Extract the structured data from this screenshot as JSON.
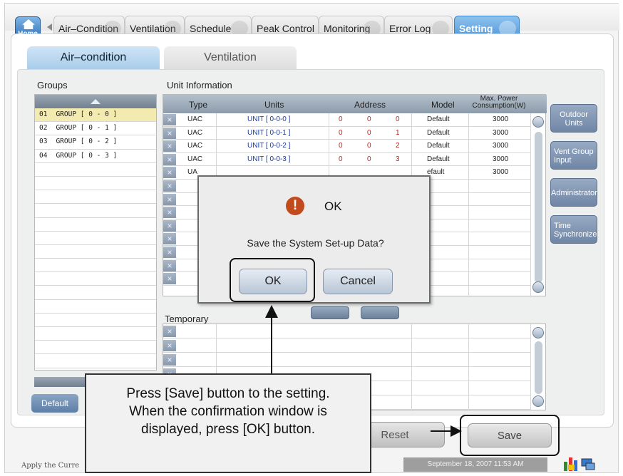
{
  "top_tabs": [
    {
      "label": "Air–Condition"
    },
    {
      "label": "Ventilation"
    },
    {
      "label": "Schedule"
    },
    {
      "label": "Peak Control"
    },
    {
      "label": "Monitoring"
    },
    {
      "label": "Error Log"
    },
    {
      "label": "Setting"
    }
  ],
  "home_label": "Home",
  "sub_tabs": {
    "air": "Air–condition",
    "vent": "Ventilation"
  },
  "groups": {
    "heading": "Groups",
    "items": [
      {
        "num": "01",
        "name": "GROUP [ 0 - 0 ]"
      },
      {
        "num": "02",
        "name": "GROUP [ 0 - 1 ]"
      },
      {
        "num": "03",
        "name": "GROUP [ 0 - 2 ]"
      },
      {
        "num": "04",
        "name": "GROUP [ 0 - 3 ]"
      }
    ]
  },
  "unit_info": {
    "heading": "Unit Information",
    "columns": {
      "type": "Type",
      "units": "Units",
      "address": "Address",
      "model": "Model",
      "max_power_1": "Max. Power",
      "max_power_2": "Consumption(W)"
    },
    "rows": [
      {
        "type": "UAC",
        "unit": "UNIT [ 0-0-0 ]",
        "a1": "0",
        "a2": "0",
        "a3": "0",
        "model": "Default",
        "power": "3000"
      },
      {
        "type": "UAC",
        "unit": "UNIT [ 0-0-1 ]",
        "a1": "0",
        "a2": "0",
        "a3": "1",
        "model": "Default",
        "power": "3000"
      },
      {
        "type": "UAC",
        "unit": "UNIT [ 0-0-2 ]",
        "a1": "0",
        "a2": "0",
        "a3": "2",
        "model": "Default",
        "power": "3000"
      },
      {
        "type": "UAC",
        "unit": "UNIT [ 0-0-3 ]",
        "a1": "0",
        "a2": "0",
        "a3": "3",
        "model": "Default",
        "power": "3000"
      },
      {
        "type": "UA",
        "unit": "",
        "a1": "",
        "a2": "",
        "a3": "",
        "model": "efault",
        "power": "3000"
      }
    ]
  },
  "temporary_heading": "Temporary",
  "side_buttons": {
    "outdoor": "Outdoor Units",
    "vent_group": "Vent Group Input",
    "administrator": "Administrator",
    "time_sync": "Time Synchronize"
  },
  "default_button": "Default",
  "reset_button": "Reset",
  "save_button": "Save",
  "status_text": "Apply the Curre",
  "datetime": "September 18, 2007 11:53 AM",
  "dialog": {
    "title": "OK",
    "message": "Save the System Set-up Data?",
    "ok": "OK",
    "cancel": "Cancel"
  },
  "callout": {
    "line1": "Press [Save] button to the setting.",
    "line2": "When the confirmation window is",
    "line3": "displayed, press [OK] button."
  },
  "colors": {
    "accent": "#4b93d6",
    "address_red": "#c21f1f",
    "unit_blue": "#1a3a9c",
    "selected_row": "#f3eab0"
  }
}
